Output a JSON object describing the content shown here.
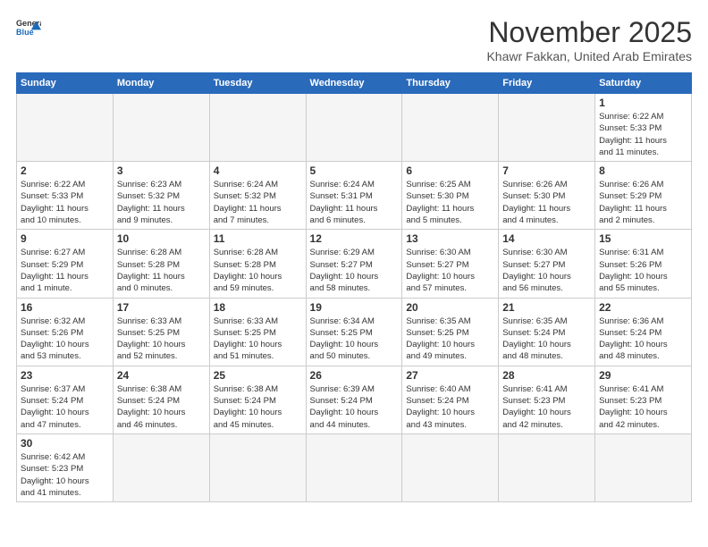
{
  "header": {
    "logo_general": "General",
    "logo_blue": "Blue",
    "month_title": "November 2025",
    "subtitle": "Khawr Fakkan, United Arab Emirates"
  },
  "weekdays": [
    "Sunday",
    "Monday",
    "Tuesday",
    "Wednesday",
    "Thursday",
    "Friday",
    "Saturday"
  ],
  "weeks": [
    [
      {
        "day": "",
        "info": ""
      },
      {
        "day": "",
        "info": ""
      },
      {
        "day": "",
        "info": ""
      },
      {
        "day": "",
        "info": ""
      },
      {
        "day": "",
        "info": ""
      },
      {
        "day": "",
        "info": ""
      },
      {
        "day": "1",
        "info": "Sunrise: 6:22 AM\nSunset: 5:33 PM\nDaylight: 11 hours\nand 11 minutes."
      }
    ],
    [
      {
        "day": "2",
        "info": "Sunrise: 6:22 AM\nSunset: 5:33 PM\nDaylight: 11 hours\nand 10 minutes."
      },
      {
        "day": "3",
        "info": "Sunrise: 6:23 AM\nSunset: 5:32 PM\nDaylight: 11 hours\nand 9 minutes."
      },
      {
        "day": "4",
        "info": "Sunrise: 6:24 AM\nSunset: 5:32 PM\nDaylight: 11 hours\nand 7 minutes."
      },
      {
        "day": "5",
        "info": "Sunrise: 6:24 AM\nSunset: 5:31 PM\nDaylight: 11 hours\nand 6 minutes."
      },
      {
        "day": "6",
        "info": "Sunrise: 6:25 AM\nSunset: 5:30 PM\nDaylight: 11 hours\nand 5 minutes."
      },
      {
        "day": "7",
        "info": "Sunrise: 6:26 AM\nSunset: 5:30 PM\nDaylight: 11 hours\nand 4 minutes."
      },
      {
        "day": "8",
        "info": "Sunrise: 6:26 AM\nSunset: 5:29 PM\nDaylight: 11 hours\nand 2 minutes."
      }
    ],
    [
      {
        "day": "9",
        "info": "Sunrise: 6:27 AM\nSunset: 5:29 PM\nDaylight: 11 hours\nand 1 minute."
      },
      {
        "day": "10",
        "info": "Sunrise: 6:28 AM\nSunset: 5:28 PM\nDaylight: 11 hours\nand 0 minutes."
      },
      {
        "day": "11",
        "info": "Sunrise: 6:28 AM\nSunset: 5:28 PM\nDaylight: 10 hours\nand 59 minutes."
      },
      {
        "day": "12",
        "info": "Sunrise: 6:29 AM\nSunset: 5:27 PM\nDaylight: 10 hours\nand 58 minutes."
      },
      {
        "day": "13",
        "info": "Sunrise: 6:30 AM\nSunset: 5:27 PM\nDaylight: 10 hours\nand 57 minutes."
      },
      {
        "day": "14",
        "info": "Sunrise: 6:30 AM\nSunset: 5:27 PM\nDaylight: 10 hours\nand 56 minutes."
      },
      {
        "day": "15",
        "info": "Sunrise: 6:31 AM\nSunset: 5:26 PM\nDaylight: 10 hours\nand 55 minutes."
      }
    ],
    [
      {
        "day": "16",
        "info": "Sunrise: 6:32 AM\nSunset: 5:26 PM\nDaylight: 10 hours\nand 53 minutes."
      },
      {
        "day": "17",
        "info": "Sunrise: 6:33 AM\nSunset: 5:25 PM\nDaylight: 10 hours\nand 52 minutes."
      },
      {
        "day": "18",
        "info": "Sunrise: 6:33 AM\nSunset: 5:25 PM\nDaylight: 10 hours\nand 51 minutes."
      },
      {
        "day": "19",
        "info": "Sunrise: 6:34 AM\nSunset: 5:25 PM\nDaylight: 10 hours\nand 50 minutes."
      },
      {
        "day": "20",
        "info": "Sunrise: 6:35 AM\nSunset: 5:25 PM\nDaylight: 10 hours\nand 49 minutes."
      },
      {
        "day": "21",
        "info": "Sunrise: 6:35 AM\nSunset: 5:24 PM\nDaylight: 10 hours\nand 48 minutes."
      },
      {
        "day": "22",
        "info": "Sunrise: 6:36 AM\nSunset: 5:24 PM\nDaylight: 10 hours\nand 48 minutes."
      }
    ],
    [
      {
        "day": "23",
        "info": "Sunrise: 6:37 AM\nSunset: 5:24 PM\nDaylight: 10 hours\nand 47 minutes."
      },
      {
        "day": "24",
        "info": "Sunrise: 6:38 AM\nSunset: 5:24 PM\nDaylight: 10 hours\nand 46 minutes."
      },
      {
        "day": "25",
        "info": "Sunrise: 6:38 AM\nSunset: 5:24 PM\nDaylight: 10 hours\nand 45 minutes."
      },
      {
        "day": "26",
        "info": "Sunrise: 6:39 AM\nSunset: 5:24 PM\nDaylight: 10 hours\nand 44 minutes."
      },
      {
        "day": "27",
        "info": "Sunrise: 6:40 AM\nSunset: 5:24 PM\nDaylight: 10 hours\nand 43 minutes."
      },
      {
        "day": "28",
        "info": "Sunrise: 6:41 AM\nSunset: 5:23 PM\nDaylight: 10 hours\nand 42 minutes."
      },
      {
        "day": "29",
        "info": "Sunrise: 6:41 AM\nSunset: 5:23 PM\nDaylight: 10 hours\nand 42 minutes."
      }
    ],
    [
      {
        "day": "30",
        "info": "Sunrise: 6:42 AM\nSunset: 5:23 PM\nDaylight: 10 hours\nand 41 minutes."
      },
      {
        "day": "",
        "info": ""
      },
      {
        "day": "",
        "info": ""
      },
      {
        "day": "",
        "info": ""
      },
      {
        "day": "",
        "info": ""
      },
      {
        "day": "",
        "info": ""
      },
      {
        "day": "",
        "info": ""
      }
    ]
  ]
}
